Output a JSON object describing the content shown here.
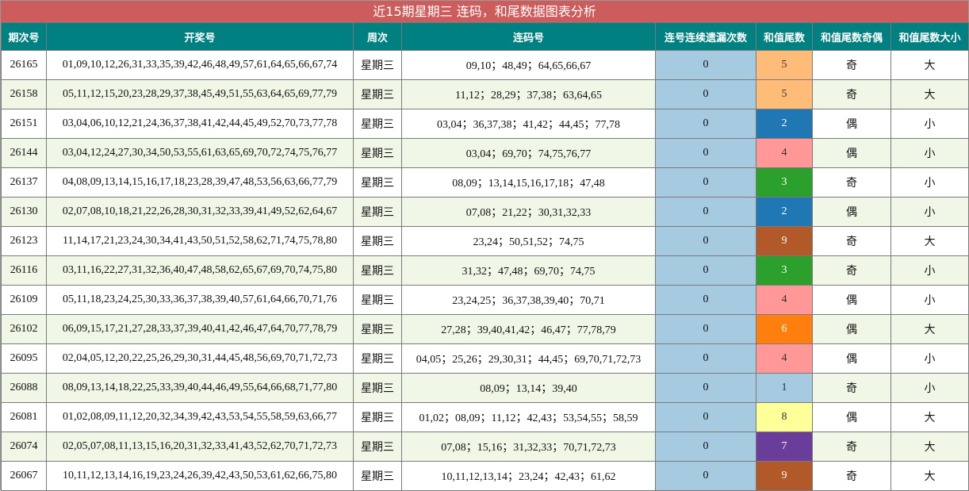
{
  "title": "近15期星期三 连码，和尾数据图表分析",
  "headers": [
    "期次号",
    "开奖号",
    "周次",
    "连码号",
    "连号连续遗漏次数",
    "和值尾数",
    "和值尾数奇偶",
    "和值尾数大小"
  ],
  "colors": {
    "title_bg": "#cd5c5c",
    "header_bg": "#008080",
    "miss_bg": "#a6cbe0",
    "even_row_bg": "#f0f7e6",
    "sum_tail": {
      "1": "#a6cbe0",
      "2": "#1f77b4",
      "3": "#2ca02c",
      "4": "#ff9896",
      "5": "#ffbb78",
      "6": "#ff7f0e",
      "7": "#6a3d9a",
      "8": "#ffff99",
      "9": "#b15928"
    }
  },
  "rows": [
    {
      "issue": "26165",
      "numbers": "01,09,10,12,26,31,33,35,39,42,46,48,49,57,61,64,65,66,67,74",
      "week": "星期三",
      "consecutive": "09,10；48,49；64,65,66,67",
      "miss": "0",
      "sum_tail": "5",
      "parity": "奇",
      "size": "大"
    },
    {
      "issue": "26158",
      "numbers": "05,11,12,15,20,23,28,29,37,38,45,49,51,55,63,64,65,69,77,79",
      "week": "星期三",
      "consecutive": "11,12；28,29；37,38；63,64,65",
      "miss": "0",
      "sum_tail": "5",
      "parity": "奇",
      "size": "大"
    },
    {
      "issue": "26151",
      "numbers": "03,04,06,10,12,21,24,36,37,38,41,42,44,45,49,52,70,73,77,78",
      "week": "星期三",
      "consecutive": "03,04；36,37,38；41,42；44,45；77,78",
      "miss": "0",
      "sum_tail": "2",
      "parity": "偶",
      "size": "小"
    },
    {
      "issue": "26144",
      "numbers": "03,04,12,24,27,30,34,50,53,55,61,63,65,69,70,72,74,75,76,77",
      "week": "星期三",
      "consecutive": "03,04；69,70；74,75,76,77",
      "miss": "0",
      "sum_tail": "4",
      "parity": "偶",
      "size": "小"
    },
    {
      "issue": "26137",
      "numbers": "04,08,09,13,14,15,16,17,18,23,28,39,47,48,53,56,63,66,77,79",
      "week": "星期三",
      "consecutive": "08,09；13,14,15,16,17,18；47,48",
      "miss": "0",
      "sum_tail": "3",
      "parity": "奇",
      "size": "小"
    },
    {
      "issue": "26130",
      "numbers": "02,07,08,10,18,21,22,26,28,30,31,32,33,39,41,49,52,62,64,67",
      "week": "星期三",
      "consecutive": "07,08；21,22；30,31,32,33",
      "miss": "0",
      "sum_tail": "2",
      "parity": "偶",
      "size": "小"
    },
    {
      "issue": "26123",
      "numbers": "11,14,17,21,23,24,30,34,41,43,50,51,52,58,62,71,74,75,78,80",
      "week": "星期三",
      "consecutive": "23,24；50,51,52；74,75",
      "miss": "0",
      "sum_tail": "9",
      "parity": "奇",
      "size": "大"
    },
    {
      "issue": "26116",
      "numbers": "03,11,16,22,27,31,32,36,40,47,48,58,62,65,67,69,70,74,75,80",
      "week": "星期三",
      "consecutive": "31,32；47,48；69,70；74,75",
      "miss": "0",
      "sum_tail": "3",
      "parity": "奇",
      "size": "小"
    },
    {
      "issue": "26109",
      "numbers": "05,11,18,23,24,25,30,33,36,37,38,39,40,57,61,64,66,70,71,76",
      "week": "星期三",
      "consecutive": "23,24,25；36,37,38,39,40；70,71",
      "miss": "0",
      "sum_tail": "4",
      "parity": "偶",
      "size": "小"
    },
    {
      "issue": "26102",
      "numbers": "06,09,15,17,21,27,28,33,37,39,40,41,42,46,47,64,70,77,78,79",
      "week": "星期三",
      "consecutive": "27,28；39,40,41,42；46,47；77,78,79",
      "miss": "0",
      "sum_tail": "6",
      "parity": "偶",
      "size": "大"
    },
    {
      "issue": "26095",
      "numbers": "02,04,05,12,20,22,25,26,29,30,31,44,45,48,56,69,70,71,72,73",
      "week": "星期三",
      "consecutive": "04,05；25,26；29,30,31；44,45；69,70,71,72,73",
      "miss": "0",
      "sum_tail": "4",
      "parity": "偶",
      "size": "小"
    },
    {
      "issue": "26088",
      "numbers": "08,09,13,14,18,22,25,33,39,40,44,46,49,55,64,66,68,71,77,80",
      "week": "星期三",
      "consecutive": "08,09；13,14；39,40",
      "miss": "0",
      "sum_tail": "1",
      "parity": "奇",
      "size": "小"
    },
    {
      "issue": "26081",
      "numbers": "01,02,08,09,11,12,20,32,34,39,42,43,53,54,55,58,59,63,66,77",
      "week": "星期三",
      "consecutive": "01,02；08,09；11,12；42,43；53,54,55；58,59",
      "miss": "0",
      "sum_tail": "8",
      "parity": "偶",
      "size": "大"
    },
    {
      "issue": "26074",
      "numbers": "02,05,07,08,11,13,15,16,20,31,32,33,41,43,52,62,70,71,72,73",
      "week": "星期三",
      "consecutive": "07,08；15,16；31,32,33；70,71,72,73",
      "miss": "0",
      "sum_tail": "7",
      "parity": "奇",
      "size": "大"
    },
    {
      "issue": "26067",
      "numbers": "10,11,12,13,14,16,19,23,24,26,39,42,43,50,53,61,62,66,75,80",
      "week": "星期三",
      "consecutive": "10,11,12,13,14；23,24；42,43；61,62",
      "miss": "0",
      "sum_tail": "9",
      "parity": "奇",
      "size": "大"
    }
  ]
}
